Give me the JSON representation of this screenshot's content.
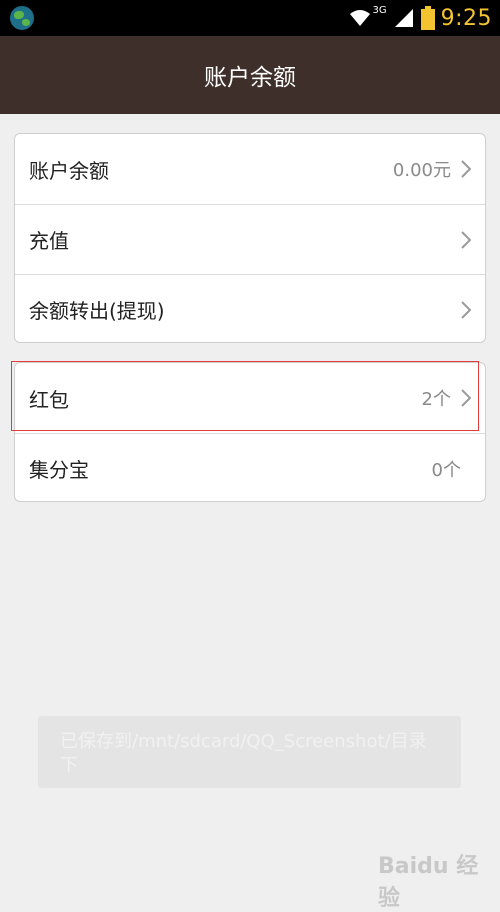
{
  "status_bar": {
    "network_label": "3G",
    "time": "9:25",
    "time_color": "#f4c430"
  },
  "header": {
    "title": "账户余额",
    "background_color": "#3f2f2a"
  },
  "groups": [
    {
      "items": [
        {
          "label": "账户余额",
          "value": "0.00元",
          "chevron": true
        },
        {
          "label": "充值",
          "value": "",
          "chevron": true
        },
        {
          "label": "余额转出(提现)",
          "value": "",
          "chevron": true
        }
      ]
    },
    {
      "items": [
        {
          "label": "红包",
          "value": "2个",
          "chevron": true
        },
        {
          "label": "集分宝",
          "value": "0个",
          "chevron": false
        }
      ]
    }
  ],
  "toast": {
    "text": "已保存到/mnt/sdcard/QQ_Screenshot/目录下"
  },
  "watermark": {
    "text": "Baidu 经验"
  }
}
